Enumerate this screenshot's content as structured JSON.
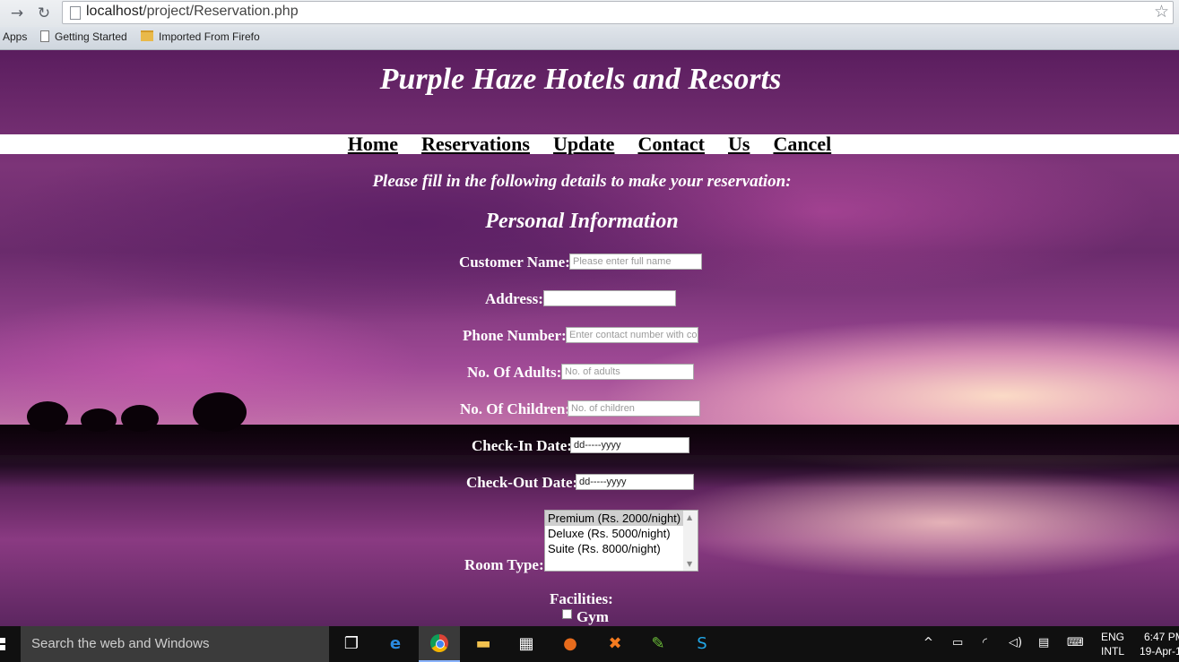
{
  "browser": {
    "url_host": "localhost",
    "url_path": "/project/Reservation.php",
    "bookmarks": [
      "Apps",
      "Getting Started",
      "Imported From Firefo"
    ]
  },
  "site": {
    "title": "Purple Haze Hotels and Resorts",
    "nav": [
      "Home",
      "Reservations",
      "Update",
      "Contact",
      "Us",
      "Cancel"
    ],
    "intro": "Please fill in the following details to make your reservation:",
    "section_title": "Personal Information"
  },
  "form": {
    "customer_name": {
      "label": "Customer Name:",
      "placeholder": "Please enter full name"
    },
    "address": {
      "label": "Address:",
      "placeholder": ""
    },
    "phone": {
      "label": "Phone Number:",
      "placeholder": "Enter contact number with co"
    },
    "adults": {
      "label": "No. Of Adults:",
      "placeholder": "No. of adults"
    },
    "children": {
      "label": "No. Of Children:",
      "placeholder": "No. of children"
    },
    "checkin": {
      "label": "Check-In Date:",
      "value": "dd-----yyyy"
    },
    "checkout": {
      "label": "Check-Out Date:",
      "value": "dd-----yyyy"
    },
    "room_type": {
      "label": "Room Type:",
      "options": [
        "Premium (Rs. 2000/night)",
        "Deluxe (Rs. 5000/night)",
        "Suite (Rs. 8000/night)"
      ],
      "selected": "Premium (Rs. 2000/night)"
    },
    "facilities": {
      "label": "Facilities:",
      "items": [
        "Gym"
      ]
    }
  },
  "taskbar": {
    "search_placeholder": "Search the web and Windows",
    "lang_top": "ENG",
    "lang_bottom": "INTL",
    "time": "6:47 PM",
    "date": "19-Apr-1"
  },
  "colors": {
    "page_text": "#ffffff",
    "nav_bar_bg": "#ffffff",
    "taskbar_bg": "#101010"
  }
}
